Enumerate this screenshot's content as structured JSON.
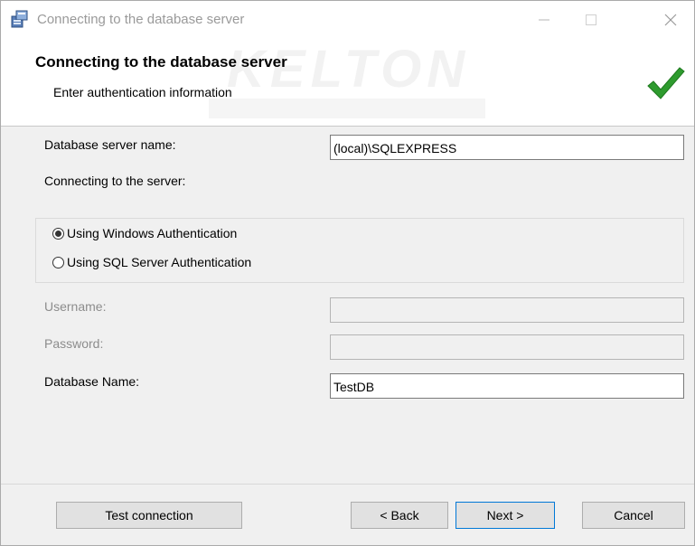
{
  "window": {
    "title": "Connecting to the database server"
  },
  "header": {
    "title": "Connecting to the database server",
    "subtitle": "Enter authentication information",
    "watermark": "KELTON"
  },
  "form": {
    "server_name_label": "Database server name:",
    "server_name_value": "(local)\\SQLEXPRESS",
    "connecting_label": "Connecting to the server:",
    "auth_windows_label": "Using Windows Authentication",
    "auth_sql_label": "Using SQL Server Authentication",
    "auth_selected": "windows",
    "username_label": "Username:",
    "username_value": "",
    "password_label": "Password:",
    "password_value": "",
    "database_name_label": "Database Name:",
    "database_name_value": "TestDB"
  },
  "buttons": {
    "test_connection": "Test connection",
    "back": "< Back",
    "next": "Next >",
    "cancel": "Cancel"
  },
  "colors": {
    "check_green": "#2e9b2e",
    "primary_border": "#0078d7"
  },
  "icons": [
    "installer-app-icon",
    "minimize-icon",
    "maximize-icon",
    "close-icon",
    "checkmark-icon"
  ]
}
